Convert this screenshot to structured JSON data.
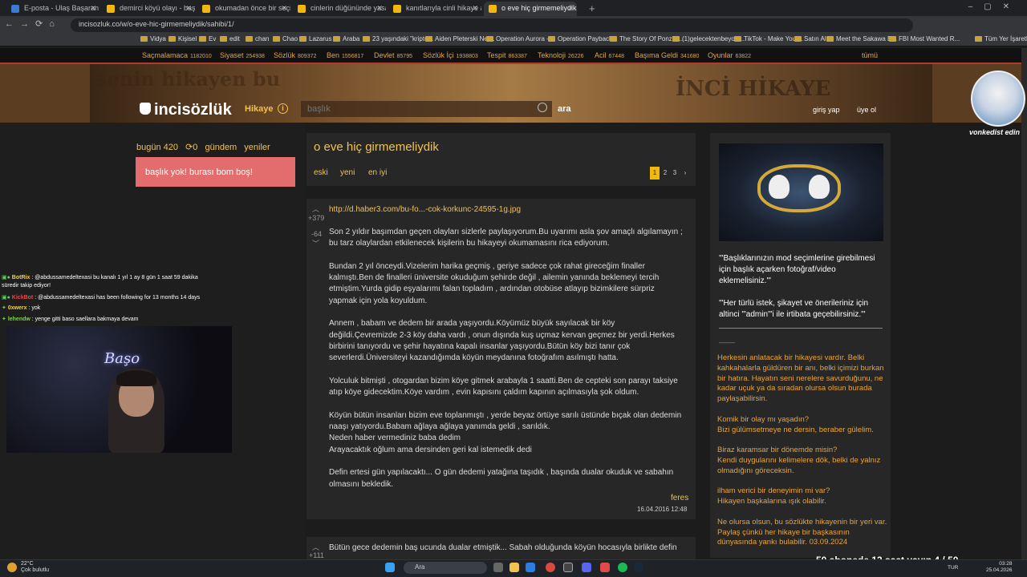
{
  "browser": {
    "tabs": [
      {
        "label": "E-posta - Ulaş Başaran - Profes"
      },
      {
        "label": "demirci köyü olayı - başlığı açı"
      },
      {
        "label": "okumadan önce bir seçimin va"
      },
      {
        "label": "cinlerin düğününde yasadıklar"
      },
      {
        "label": "kanıtlarıyla cinli hikaye anlatıy"
      },
      {
        "label": "o eve hiç girmemeliydik - başlı"
      }
    ],
    "url": "incisozluk.co/w/o-eve-hic-girmemeliydik/sahibi/1/",
    "bookmarks": [
      "Vidya",
      "Kişisel",
      "Ev",
      "edit",
      "chan",
      "Chao",
      "Lazarus",
      "Araba",
      "23 yaşındaki \"kripto...",
      "Aiden Pleterski Net...",
      "Operation Aurora -...",
      "Operation Payback...",
      "The Story Of Ponzi -...",
      "(1)gelecektenbeyoiz...",
      "TikTok - Make Your...",
      "Satın Al",
      "Meet the Sakawa B...",
      "FBI Most Wanted R...",
      "Tüm Yer İşaretleri"
    ]
  },
  "categories": [
    {
      "name": "Saçmalamaca",
      "count": "1182010"
    },
    {
      "name": "Siyaset",
      "count": "254938"
    },
    {
      "name": "Sözlük",
      "count": "809372"
    },
    {
      "name": "Ben",
      "count": "1556817"
    },
    {
      "name": "Devlet",
      "count": "85795"
    },
    {
      "name": "Sözlük İçi",
      "count": "1938803"
    },
    {
      "name": "Tespit",
      "count": "863387"
    },
    {
      "name": "Teknoloji",
      "count": "26226"
    },
    {
      "name": "Acil",
      "count": "67448"
    },
    {
      "name": "Başıma Geldi",
      "count": "341680"
    },
    {
      "name": "Oyunlar",
      "count": "63822"
    }
  ],
  "all_label": "tümü",
  "banner": {
    "slogan": "senin hikayen bu",
    "stamp": "İNCİ HİKAYE",
    "logo": "incisözlük",
    "section": "Hikaye",
    "search_placeholder": "başlık",
    "search_button": "ara",
    "login": "giriş yap",
    "signup": "üye ol"
  },
  "left": {
    "bugun": "bugün 420",
    "refresh_count": "0",
    "gundem": "gündem",
    "yeniler": "yeniler",
    "empty_msg": "başlık yok! burası bom boş!"
  },
  "chat": [
    {
      "user": "BotRix",
      "text": ": @abdussamedeltexasi bu kanalı 1 yıl 1 ay 8 gün 1 saat 59 dakika"
    },
    {
      "user": "",
      "text": "süredir takip ediyor!"
    },
    {
      "user": "KickBot",
      "text": ": @abdussamedeltexasi has been following for 13 months 14 days"
    },
    {
      "user": "0xwerx",
      "text": ": yok"
    },
    {
      "user": "lehendw",
      "text": ": yenge gitti baso saellara bakmaya devam"
    }
  ],
  "camera_sign": "Başo",
  "topic": {
    "title": "o eve hiç girmemeliydik",
    "tabs": [
      "eski",
      "yeni",
      "en iyi"
    ],
    "pages": [
      "1",
      "2",
      "3",
      "›"
    ]
  },
  "entry": {
    "up": "+379",
    "down": "-64",
    "link": "http://d.haber3.com/bu-fo...-cok-korkunc-24595-1g.jpg",
    "body": "Son 2 yıldır başımdan geçen olayları sizlerle paylaşıyorum.Bu uyarımı asla şov amaçlı algılamayın ;\nbu tarz olaylardan etkilenecek kişilerin bu hikayeyi okumamasını rica ediyorum.\n\nBundan 2 yıl önceydi.Vizelerim harika geçmiş , geriye sadece çok rahat gireceğim finaller\nkalmıştı.Ben de finalleri üniversite okuduğum şehirde değil , ailemin yanında beklemeyi tercih\netmiştim.Yurda gidip eşyalarımı falan topladım , ardından otobüse atlayıp bizimkilere sürpriz\nyapmak için yola koyuldum.\n\nAnnem , babam ve dedem bir arada yaşıyordu.Köyümüz büyük sayılacak bir köy\ndeğildi.Çevremizde 2-3 köy daha vardı , onun dışında kuş uçmaz kervan geçmez bir yerdi.Herkes\nbirbirini tanıyordu ve şehir hayatına kapalı insanlar yaşıyordu.Bütün köy bizi tanır çok\nseverlerdi.Üniversiteyi kazandığımda köyün meydanına fotoğrafım asılmıştı hatta.\n\nYolculuk bitmişti , otogardan bizim köye gitmek arabayla 1 saatti.Ben de cepteki son parayı taksiye\natıp köye gidecektim.Köye vardım , evin kapısını çaldım kapının açılmasıyla şok oldum.\n\nKöyün bütün insanları bizim eve toplanmıştı , yerde beyaz örtüye sarılı üstünde bıçak olan dedemin\nnaaşı yatıyordu.Babam ağlaya ağlaya yanımda geldi , sarıldık.\nNeden haber vermediniz baba dedim\nArayacaktık oğlum ama dersinden geri kal istemedik dedi\n\nDefin ertesi gün yapılacaktı... O gün dedemi yatağına taşıdık , başında dualar okuduk ve sabahın\nolmasını bekledik.",
    "author": "feres",
    "date": "16.04.2016 12:48"
  },
  "entry2": {
    "up": "+111",
    "text": "Bütün gece dedemin baş ucunda dualar etmiştik... Sabah olduğunda köyün hocasıyla birlikte defin"
  },
  "right": {
    "note": "'\"Başlıklarınızın mod seçimlerine girebilmesi için başlık açarken fotoğraf/video eklemelisiniz.'\"\n\n'\"Her türlü istek, şikayet ve önerileriniz için altinci '\"admin'\"i ile irtibata geçebilirsiniz.'\"",
    "dash": "____",
    "promo": "Herkesin anlatacak bir hikayesi vardır. Belki kahkahalarla güldüren bir anı, belki içimizi burkan bir hatıra. Hayatın seni nerelere savurduğunu, ne kadar uçuk ya da sıradan olursa olsun burada paylaşabilirsin.\n\nKomik bir olay mı yaşadın?\nBizi gülümsetmeye ne dersin, beraber gülelim.\n\nBiraz karamsar bir dönemde misin?\nKendi duygularını kelimelere dök, belki de yalnız olmadığını göreceksin.\n\nilham verici bir deneyimin mi var?\nHikayen başkalarına ışık olabilir.\n\nNe olursa olsun, bu sözlükte hikayenin bir yeri var. Paylaş çünkü her hikaye bir başkasının dünyasında yankı bulabilir. 03.09.2024"
  },
  "overlay": {
    "avatar_caption": "vonkedist edin",
    "subgoal": "50 abonede 12 saat yayın 4 / 50"
  },
  "taskbar": {
    "weather_temp": "22°C",
    "weather_desc": "Çok bulutlu",
    "search": "Ara",
    "lang": "TUR",
    "time": "03:28",
    "date": "25.04.2026"
  }
}
